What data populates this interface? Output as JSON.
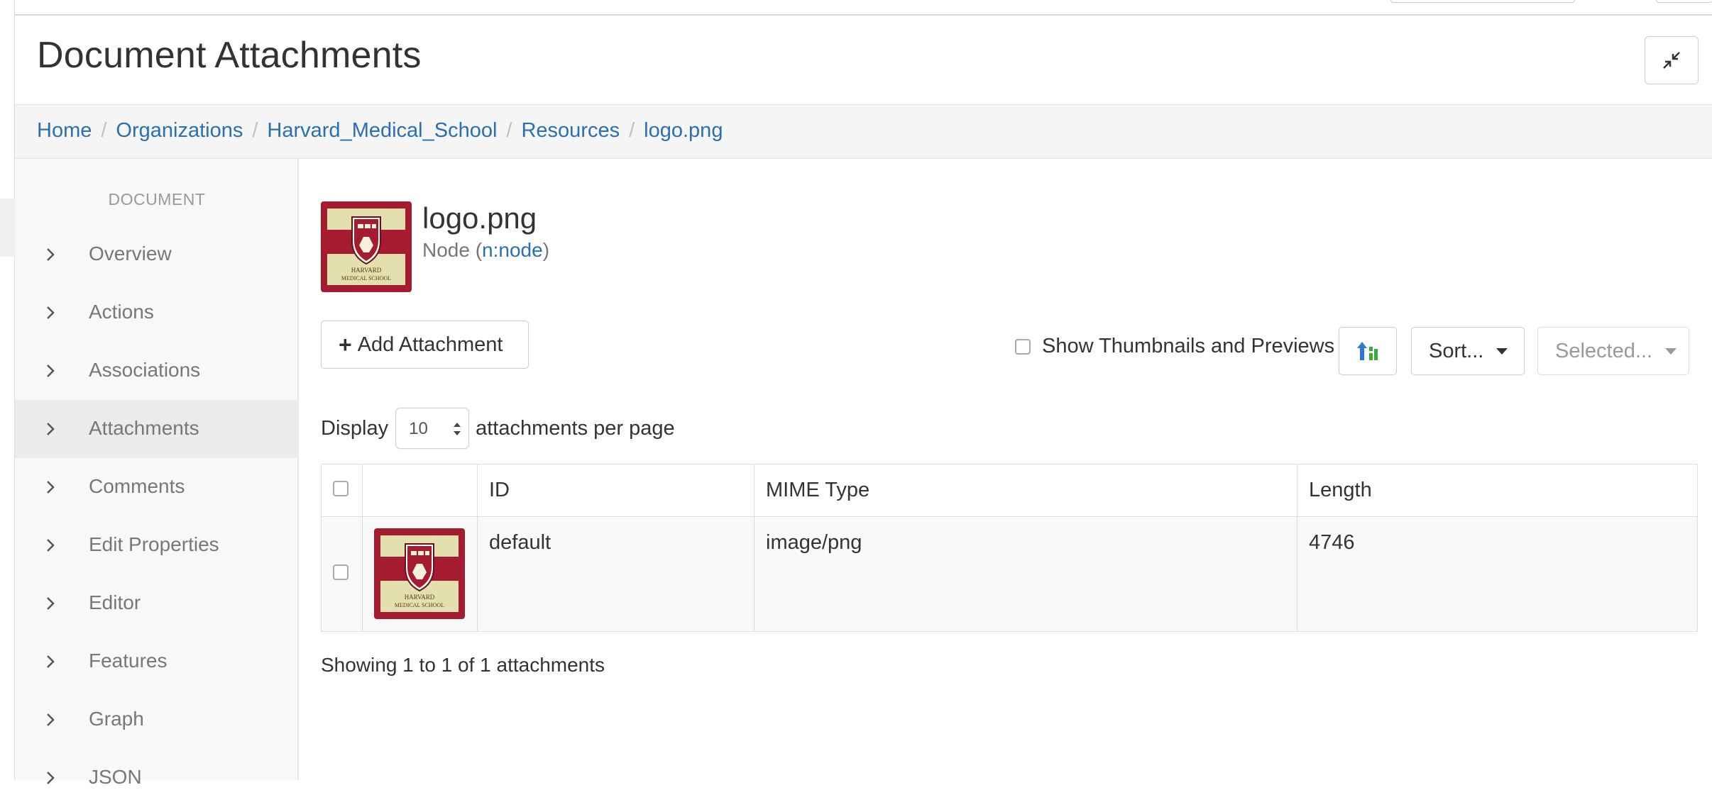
{
  "header": {
    "title": "Document Attachments",
    "collapse_icon": "compress-icon"
  },
  "breadcrumb": [
    {
      "label": "Home"
    },
    {
      "label": "Organizations"
    },
    {
      "label": "Harvard_Medical_School"
    },
    {
      "label": "Resources"
    },
    {
      "label": "logo.png"
    }
  ],
  "sidebar": {
    "heading": "DOCUMENT",
    "items": [
      {
        "label": "Overview"
      },
      {
        "label": "Actions"
      },
      {
        "label": "Associations"
      },
      {
        "label": "Attachments",
        "active": true
      },
      {
        "label": "Comments"
      },
      {
        "label": "Edit Properties"
      },
      {
        "label": "Editor"
      },
      {
        "label": "Features"
      },
      {
        "label": "Graph"
      },
      {
        "label": "JSON"
      }
    ]
  },
  "document": {
    "name": "logo.png",
    "type_prefix": "Node (",
    "type_link": "n:node",
    "type_suffix": ")",
    "logo_text_line1": "HARVARD",
    "logo_text_line2": "MEDICAL SCHOOL"
  },
  "toolbar": {
    "add_label": "Add Attachment",
    "thumbnails_label": "Show Thumbnails and Previews",
    "sort_label": "Sort...",
    "selected_label": "Selected..."
  },
  "display": {
    "prefix": "Display",
    "page_size": "10",
    "suffix": "attachments per page"
  },
  "table": {
    "headers": {
      "id": "ID",
      "mime": "MIME Type",
      "length": "Length"
    },
    "rows": [
      {
        "id": "default",
        "mime": "image/png",
        "length": "4746"
      }
    ]
  },
  "status": "Showing 1 to 1 of 1 attachments",
  "colors": {
    "link": "#2a6fb0",
    "logo_red": "#a51c30",
    "logo_cream": "#e3dfae"
  }
}
